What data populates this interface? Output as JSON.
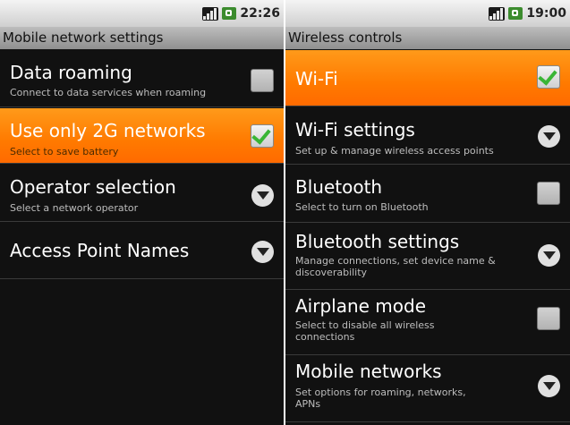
{
  "left": {
    "status": {
      "time": "22:26",
      "icons": [
        "signal-icon",
        "battery-icon"
      ]
    },
    "title": "Mobile network settings",
    "items": [
      {
        "title": "Data roaming",
        "summary": "Connect to data services when roaming",
        "widget": "checkbox",
        "checked": false,
        "highlighted": false
      },
      {
        "title": "Use only 2G networks",
        "summary": "Select to save battery",
        "widget": "checkbox",
        "checked": true,
        "highlighted": true
      },
      {
        "title": "Operator selection",
        "summary": "Select a network operator",
        "widget": "arrow",
        "highlighted": false
      },
      {
        "title": "Access Point Names",
        "summary": "",
        "widget": "arrow",
        "highlighted": false
      }
    ]
  },
  "right": {
    "status": {
      "time": "19:00",
      "icons": [
        "signal-icon",
        "battery-icon"
      ]
    },
    "title": "Wireless controls",
    "items": [
      {
        "title": "Wi-Fi",
        "summary": "",
        "widget": "checkbox",
        "checked": true,
        "highlighted": true
      },
      {
        "title": "Wi-Fi settings",
        "summary": "Set up & manage wireless access points",
        "widget": "arrow",
        "highlighted": false
      },
      {
        "title": "Bluetooth",
        "summary": "Select to turn on Bluetooth",
        "widget": "checkbox",
        "checked": false,
        "highlighted": false
      },
      {
        "title": "Bluetooth settings",
        "summary": "Manage connections, set device name & discoverability",
        "widget": "arrow",
        "highlighted": false
      },
      {
        "title": "Airplane mode",
        "summary": "Select to disable all wireless connections",
        "widget": "checkbox",
        "checked": false,
        "highlighted": false
      },
      {
        "title": "Mobile networks",
        "summary": "Set options for roaming, networks, APNs",
        "widget": "arrow",
        "highlighted": false
      }
    ]
  },
  "colors": {
    "highlight": "#ff7a00",
    "background": "#111111",
    "check": "#39b535"
  }
}
